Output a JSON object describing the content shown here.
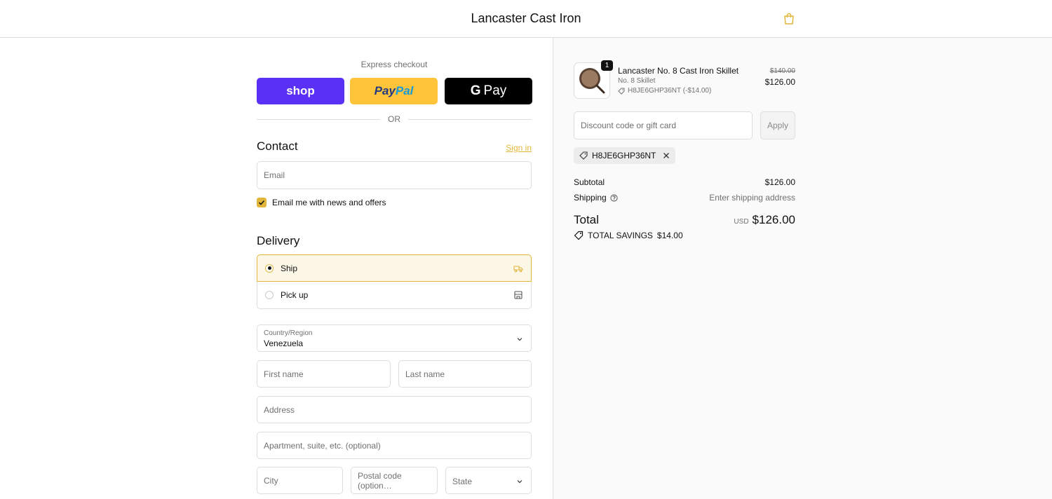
{
  "header": {
    "store_name": "Lancaster Cast Iron",
    "cart_icon": "shopping-bag-icon"
  },
  "express": {
    "label": "Express checkout",
    "shop_label": "shop",
    "paypal_part1": "Pay",
    "paypal_part2": "Pal",
    "gpay_g": "G",
    "gpay_label": "Pay",
    "or_label": "OR"
  },
  "contact": {
    "title": "Contact",
    "sign_in": "Sign in",
    "email_placeholder": "Email",
    "news_label": "Email me with news and offers",
    "news_checked": true
  },
  "delivery": {
    "title": "Delivery",
    "options": [
      {
        "label": "Ship",
        "selected": true,
        "icon": "truck-icon"
      },
      {
        "label": "Pick up",
        "selected": false,
        "icon": "store-icon"
      }
    ],
    "country_label": "Country/Region",
    "country_value": "Venezuela",
    "first_name": "First name",
    "last_name": "Last name",
    "address": "Address",
    "apartment": "Apartment, suite, etc. (optional)",
    "city": "City",
    "postal": "Postal code (option…",
    "state": "State"
  },
  "order": {
    "item": {
      "name": "Lancaster No. 8 Cast Iron Skillet",
      "variant": "No. 8 Skillet",
      "discount": "H8JE6GHP36NT (-$14.00)",
      "quantity": "1",
      "price_original": "$140.00",
      "price": "$126.00"
    },
    "discount_placeholder": "Discount code or gift card",
    "apply_label": "Apply",
    "applied_code": "H8JE6GHP36NT",
    "subtotal_label": "Subtotal",
    "subtotal_value": "$126.00",
    "shipping_label": "Shipping",
    "shipping_value": "Enter shipping address",
    "total_label": "Total",
    "currency": "USD",
    "total_value": "$126.00",
    "savings_label": "TOTAL SAVINGS",
    "savings_value": "$14.00"
  },
  "colors": {
    "accent": "#e2b63b",
    "shop_pay": "#5a31f4",
    "paypal": "#ffc439",
    "gpay": "#000000"
  }
}
